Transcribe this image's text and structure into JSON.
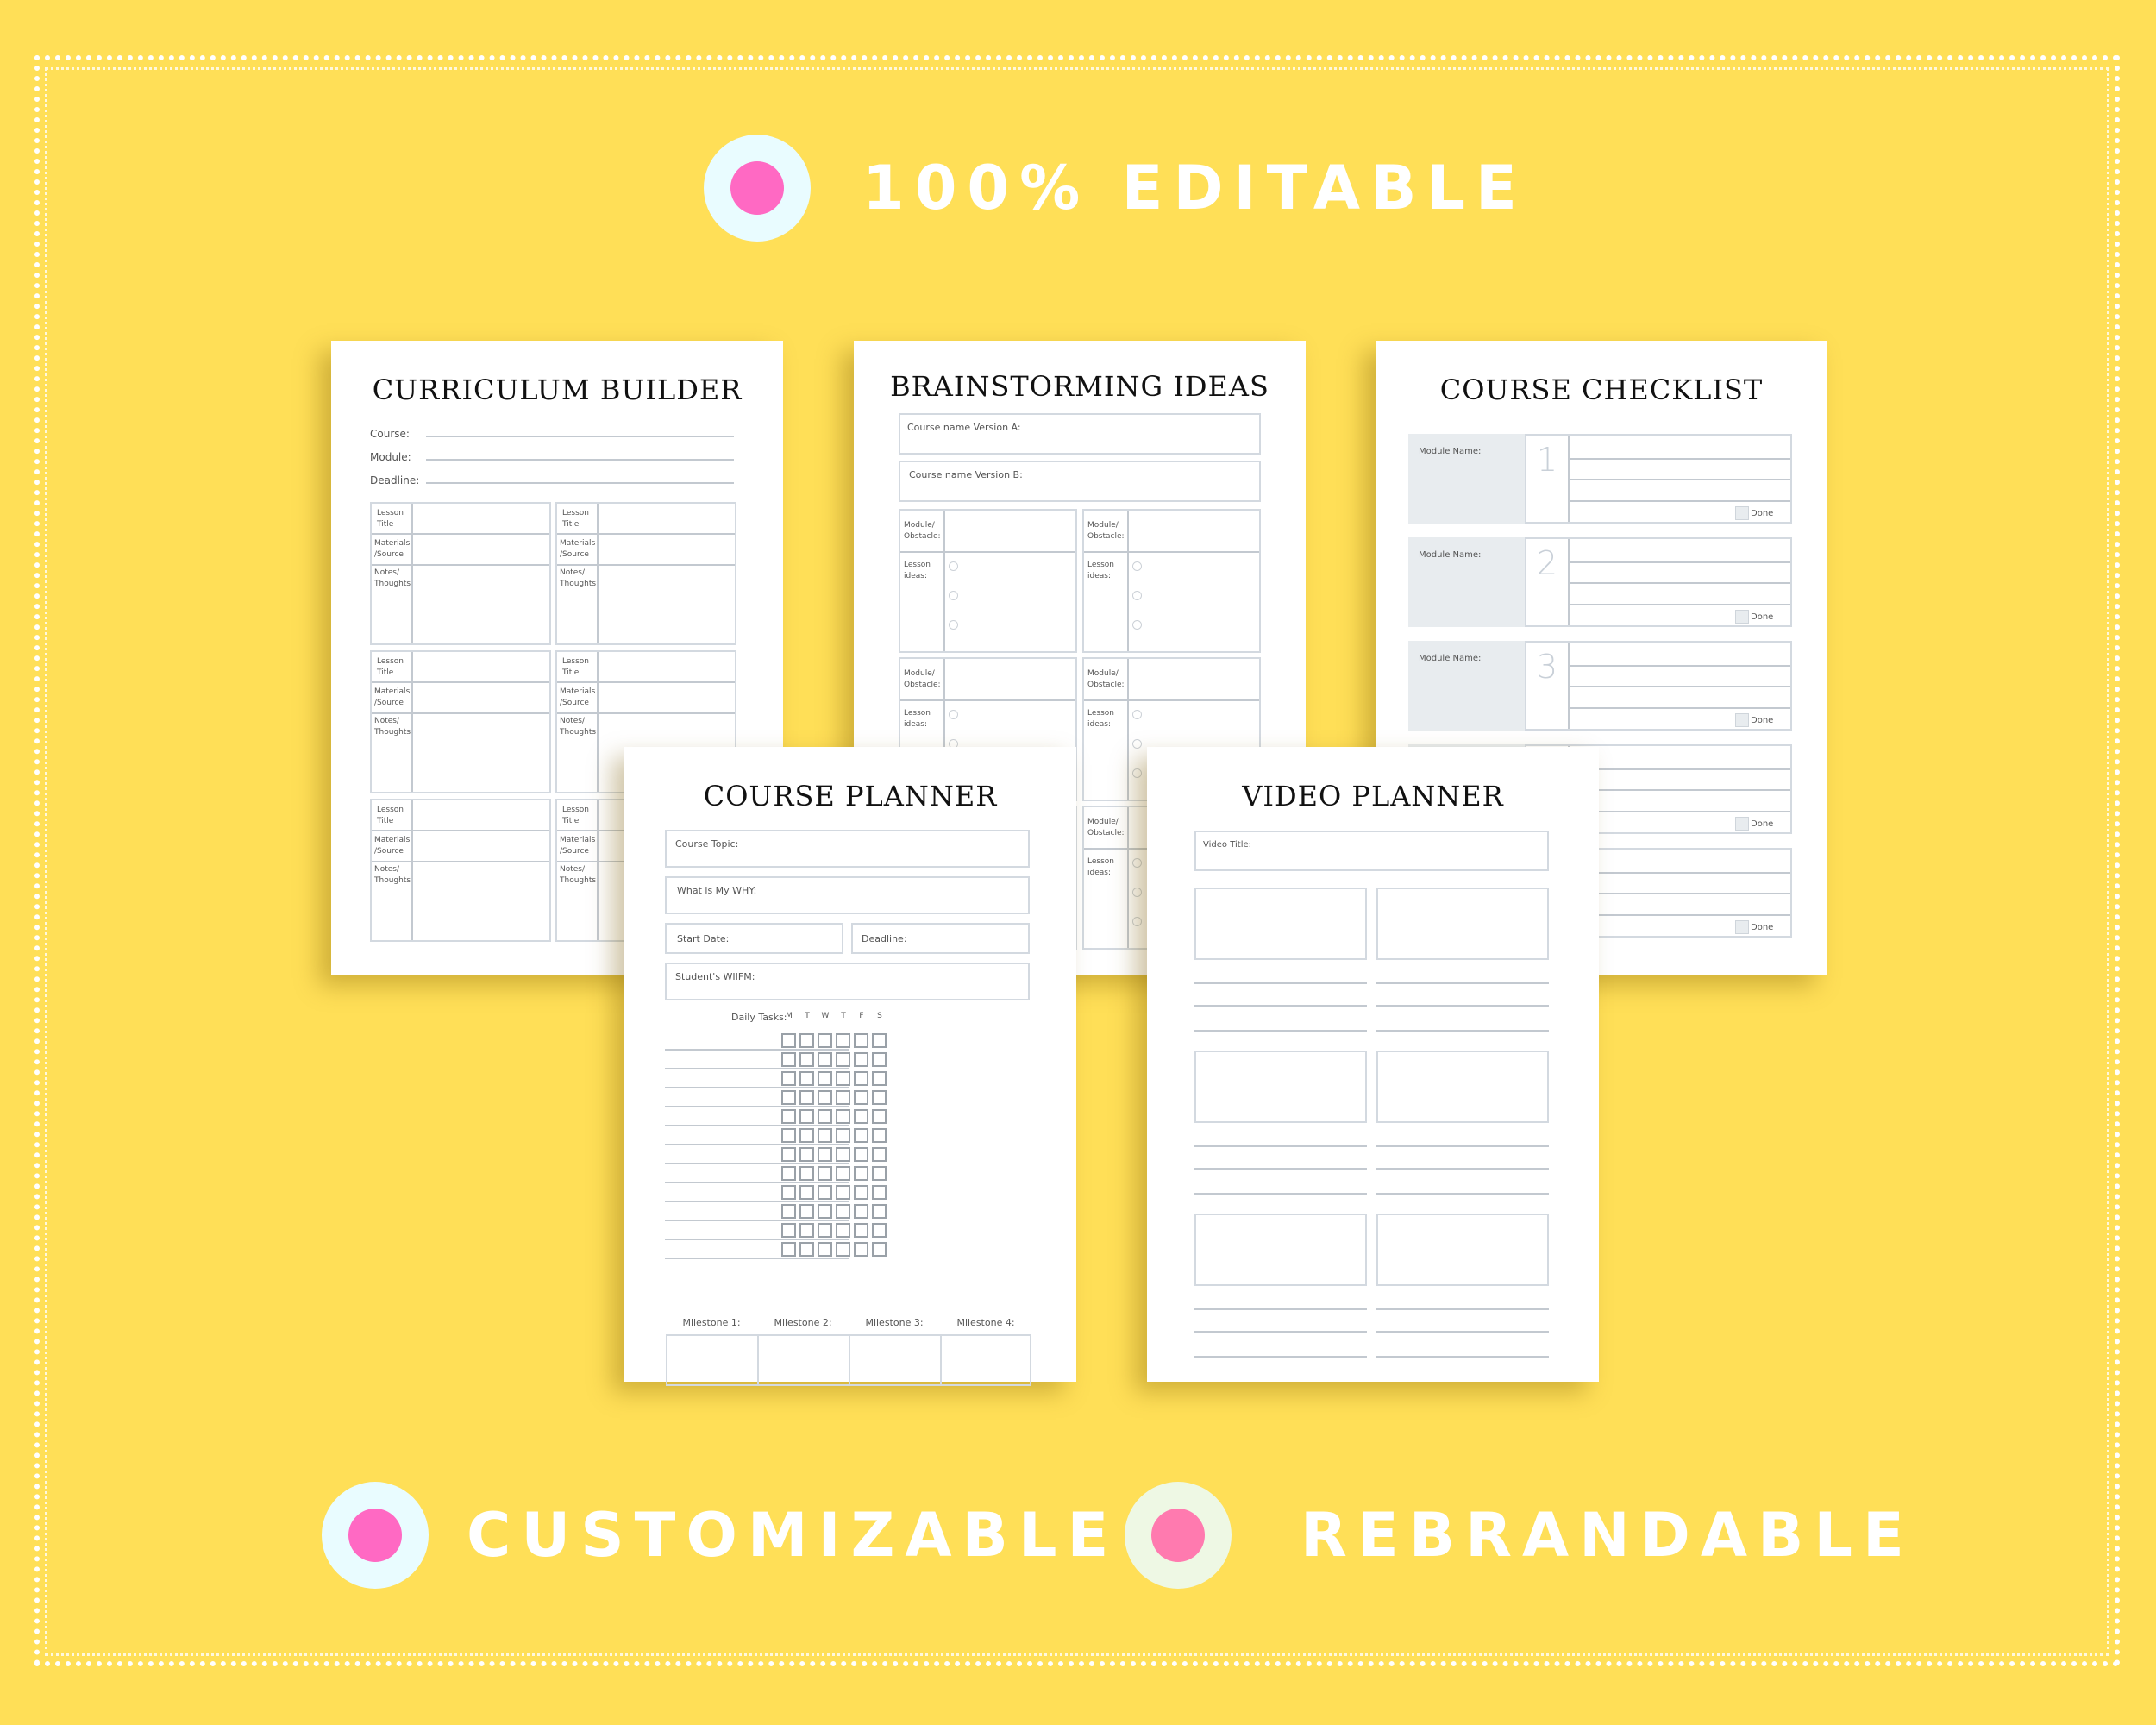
{
  "colors": {
    "background": "#ffdf57",
    "pink": "#ff69c3",
    "pink_soft": "#ff7aaf",
    "ring_light": "#e9fcff",
    "ring_green": "#eef8e4",
    "panel_gray": "#e8ecef"
  },
  "badges": {
    "top": {
      "label": "100% EDITABLE",
      "icon": "dot-icon"
    },
    "bottom_left": {
      "label": "CUSTOMIZABLE",
      "icon": "dot-icon"
    },
    "bottom_right": {
      "label": "REBRANDABLE",
      "icon": "dot-icon"
    }
  },
  "curriculum": {
    "title": "CURRICULUM BUILDER",
    "fields": [
      "Course:",
      "Module:",
      "Deadline:"
    ],
    "lesson_labels": {
      "title": "Lesson Title",
      "materials": "Materials /Source",
      "notes": "Notes/ Thoughts"
    }
  },
  "brainstorm": {
    "title": "BRAINSTORMING IDEAS",
    "version_a": "Course name Version A:",
    "version_b": "Course name Version B:",
    "module_label": "Module/ Obstacle:",
    "lesson_label": "Lesson ideas:"
  },
  "checklist": {
    "title": "COURSE CHECKLIST",
    "module_label": "Module Name:",
    "done_label": "Done",
    "numbers": [
      "1",
      "2",
      "3",
      "",
      ""
    ]
  },
  "course_planner": {
    "title": "COURSE PLANNER",
    "course_topic": "Course Topic:",
    "why": "What is My WHY:",
    "start_date": "Start Date:",
    "deadline": "Deadline:",
    "wiifm": "Student's WIIFM:",
    "daily_tasks": "Daily Tasks:",
    "days": [
      "M",
      "T",
      "W",
      "T",
      "F",
      "S"
    ],
    "milestones": [
      "Milestone 1:",
      "Milestone 2:",
      "Milestone 3:",
      "Milestone 4:"
    ]
  },
  "video_planner": {
    "title": "VIDEO PLANNER",
    "video_title": "Video Title:"
  }
}
